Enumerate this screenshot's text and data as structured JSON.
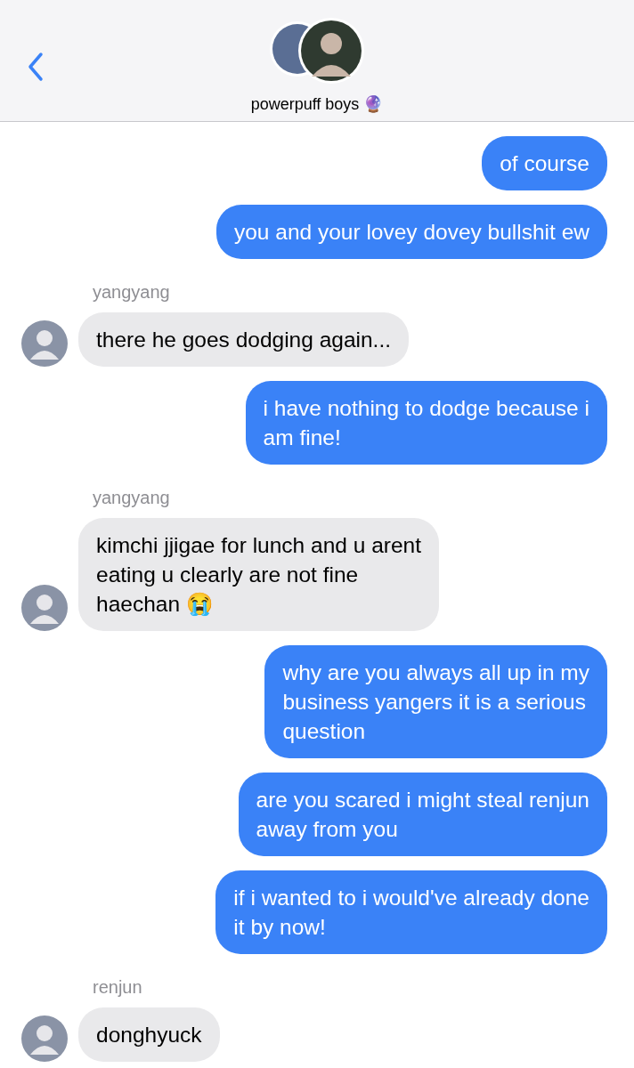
{
  "header": {
    "title": "powerpuff boys 🔮"
  },
  "messages": [
    {
      "kind": "sent",
      "lines": [
        "of course"
      ]
    },
    {
      "kind": "sent",
      "lines": [
        "you and your lovey dovey bullshit ew"
      ]
    },
    {
      "kind": "received",
      "sender": "yangyang",
      "lines": [
        "there he goes dodging again..."
      ]
    },
    {
      "kind": "sent",
      "lines": [
        "i have nothing to dodge because i",
        "am fine!"
      ]
    },
    {
      "kind": "received",
      "sender": "yangyang",
      "lines": [
        "kimchi jjigae for lunch and u arent",
        "eating u clearly are not fine",
        "haechan 😭"
      ]
    },
    {
      "kind": "sent",
      "lines": [
        "why are you always all up in my",
        "business yangers it is a serious",
        "question"
      ]
    },
    {
      "kind": "sent",
      "lines": [
        "are you scared i might steal renjun",
        "away from you"
      ]
    },
    {
      "kind": "sent",
      "lines": [
        "if i wanted to i would've already done",
        "it by now!"
      ]
    },
    {
      "kind": "received",
      "sender": "renjun",
      "lines": [
        "donghyuck"
      ]
    }
  ]
}
